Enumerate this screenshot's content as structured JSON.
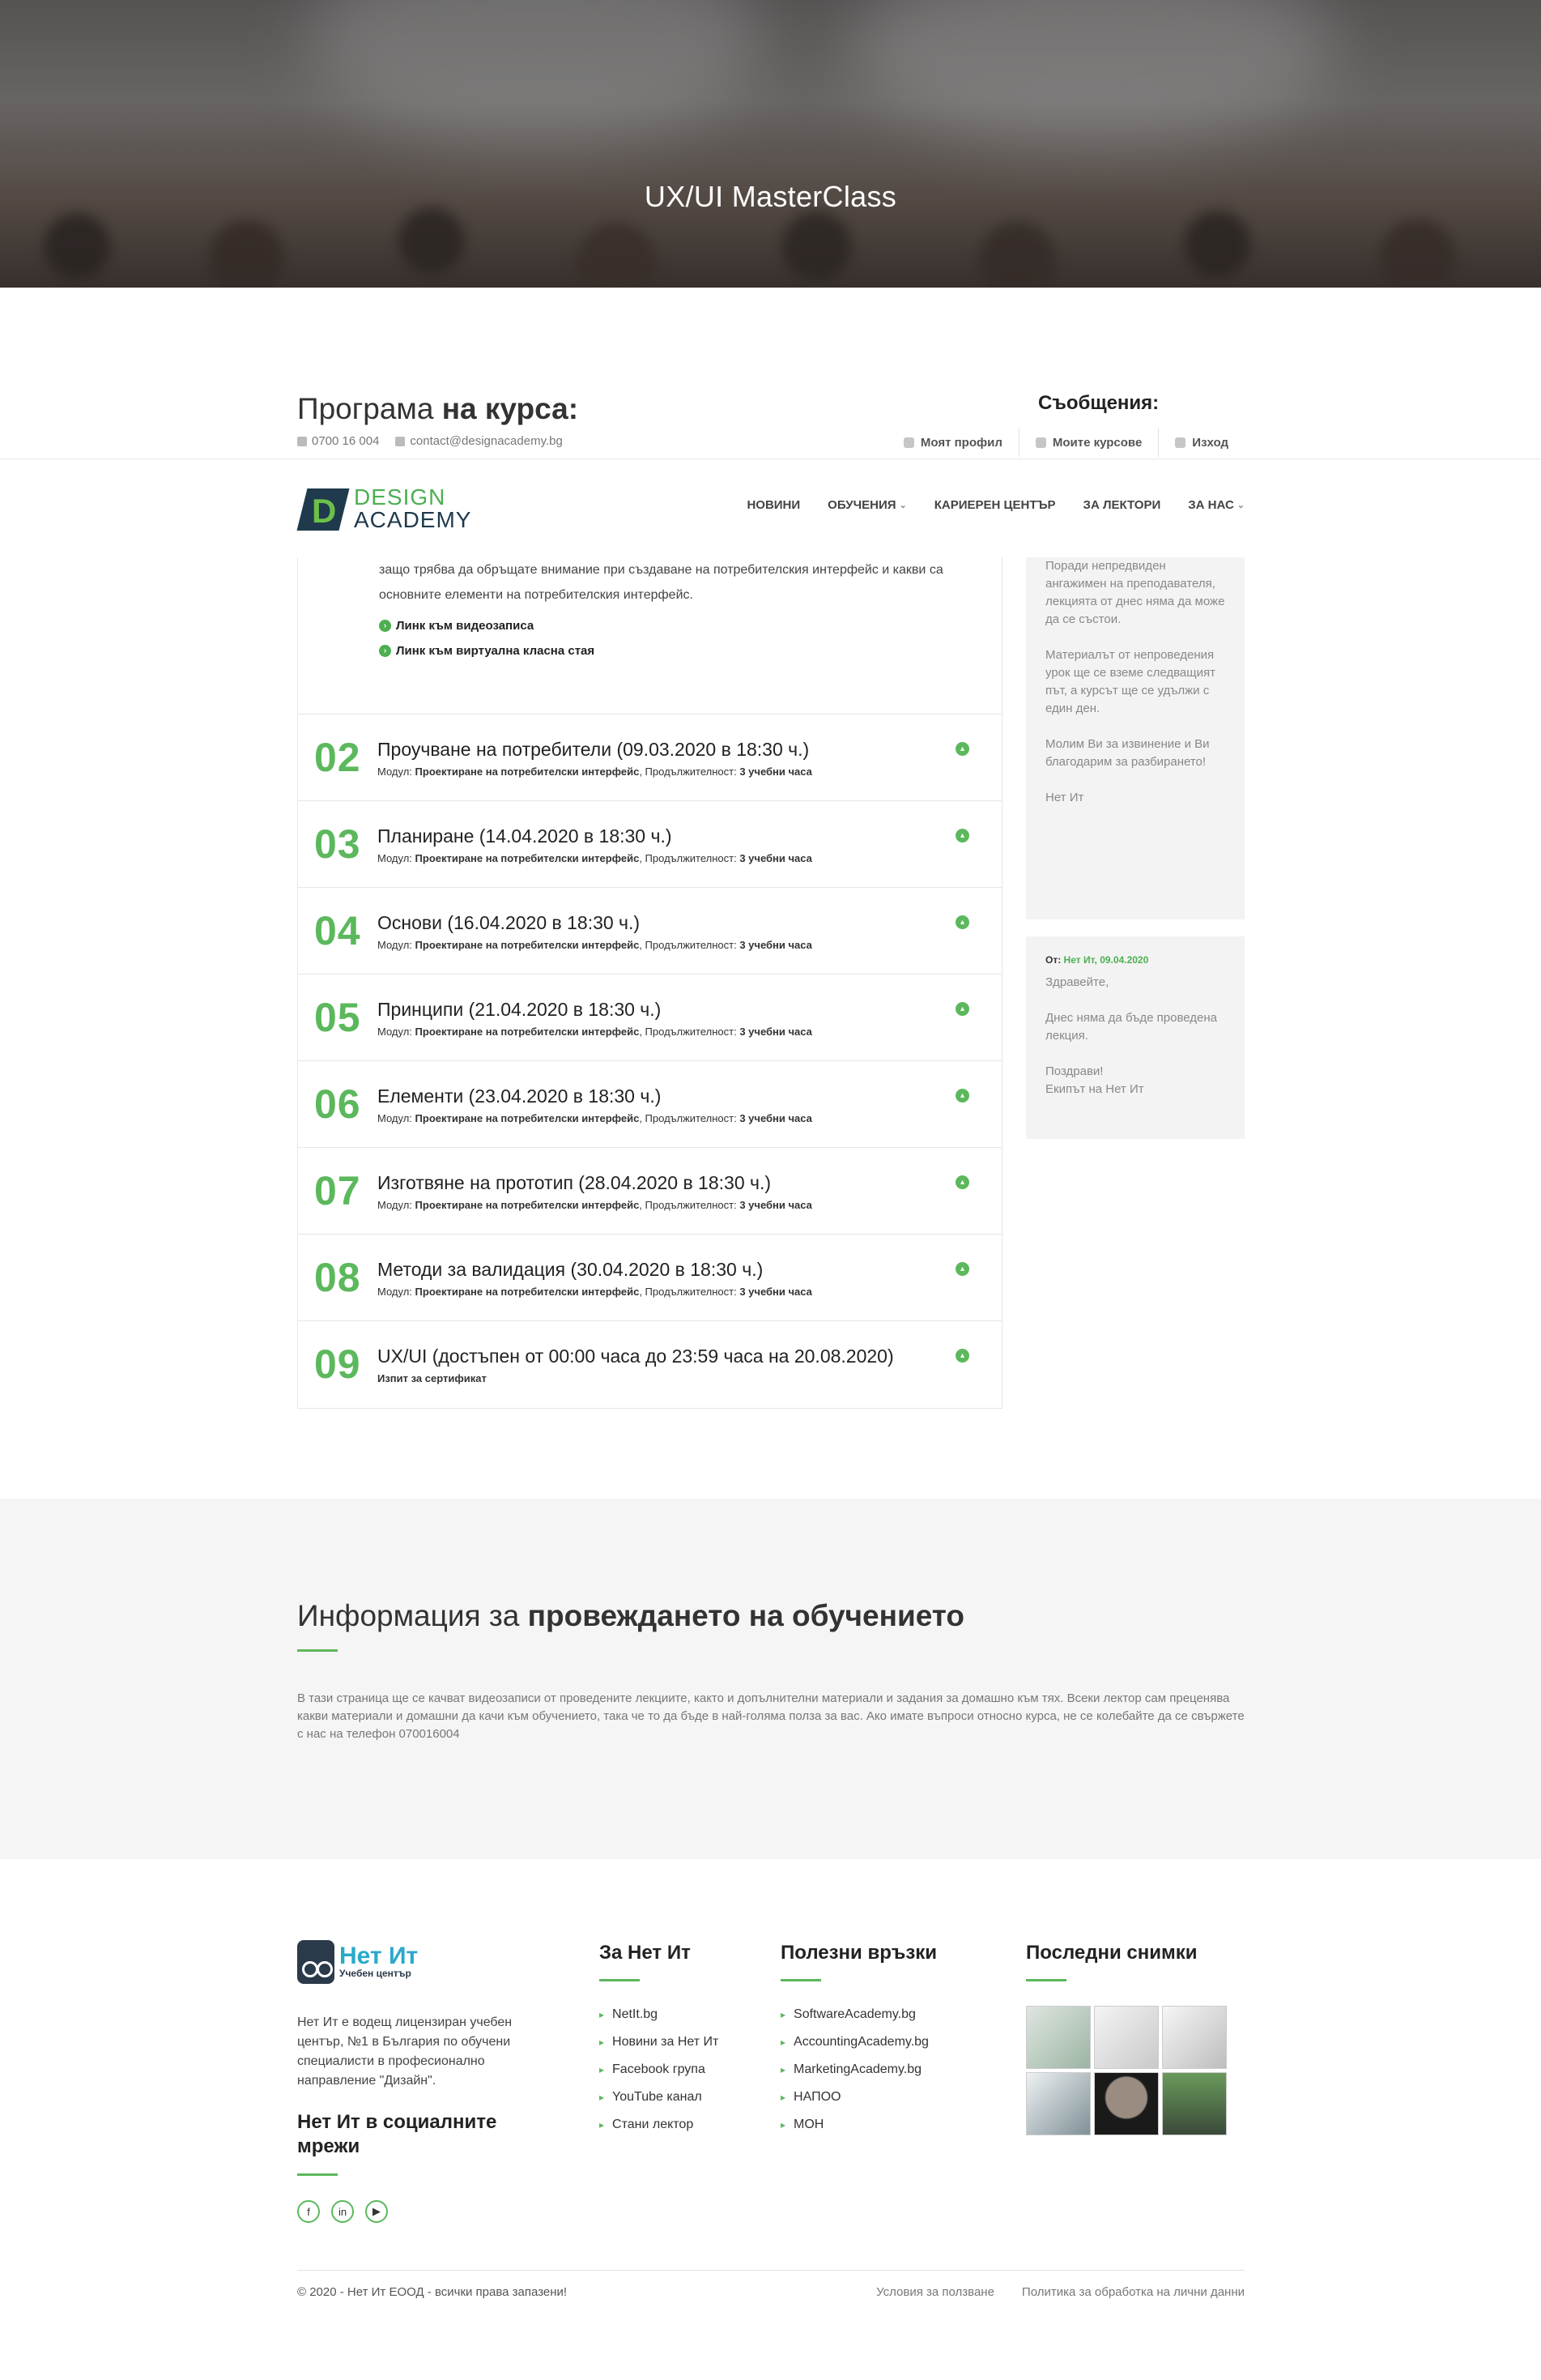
{
  "hero": {
    "title": "UX/UI MasterClass"
  },
  "header": {
    "program_light": "Програма ",
    "program_bold": "на курса:",
    "messages_title": "Съобщения:",
    "phone": "0700 16 004",
    "email": "contact@designacademy.bg",
    "user_menu": [
      "Моят профил",
      "Моите курсове",
      "Изход"
    ]
  },
  "nav": {
    "logo_line1": "DESIGN",
    "logo_line2": "ACADEMY",
    "logo_letter": "D",
    "items": [
      "НОВИНИ",
      "ОБУЧЕНИЯ",
      "КАРИЕРЕН ЦЕНТЪР",
      "ЗА ЛЕКТОРИ",
      "ЗА НАС"
    ]
  },
  "lesson_open": {
    "text": "защо трябва да обръщате внимание при създаване на потребителския интерфейс и какви са основните елементи на потребителския интерфейс.",
    "link_video": "Линк към видеозаписа",
    "link_class": "Линк към виртуална класна стая"
  },
  "lessons": [
    {
      "num": "02",
      "title": "Проучване на потребители (09.03.2020 в 18:30 ч.)",
      "sub_pre": "Модул: ",
      "sub_mod": "Проектиране на потребителски интерфейс",
      "sub_mid": ", Продължителност: ",
      "sub_dur": "3 учебни часа"
    },
    {
      "num": "03",
      "title": "Планиране (14.04.2020 в 18:30 ч.)",
      "sub_pre": "Модул: ",
      "sub_mod": "Проектиране на потребителски интерфейс",
      "sub_mid": ", Продължителност: ",
      "sub_dur": "3 учебни часа"
    },
    {
      "num": "04",
      "title": "Основи (16.04.2020 в 18:30 ч.)",
      "sub_pre": "Модул: ",
      "sub_mod": "Проектиране на потребителски интерфейс",
      "sub_mid": ", Продължителност: ",
      "sub_dur": "3 учебни часа"
    },
    {
      "num": "05",
      "title": "Принципи (21.04.2020 в 18:30 ч.)",
      "sub_pre": "Модул: ",
      "sub_mod": "Проектиране на потребителски интерфейс",
      "sub_mid": ", Продължителност: ",
      "sub_dur": "3 учебни часа"
    },
    {
      "num": "06",
      "title": "Елементи (23.04.2020 в 18:30 ч.)",
      "sub_pre": "Модул: ",
      "sub_mod": "Проектиране на потребителски интерфейс",
      "sub_mid": ", Продължителност: ",
      "sub_dur": "3 учебни часа"
    },
    {
      "num": "07",
      "title": "Изготвяне на прототип (28.04.2020 в 18:30 ч.)",
      "sub_pre": "Модул: ",
      "sub_mod": "Проектиране на потребителски интерфейс",
      "sub_mid": ", Продължителност: ",
      "sub_dur": "3 учебни часа"
    },
    {
      "num": "08",
      "title": "Методи за валидация (30.04.2020 в 18:30 ч.)",
      "sub_pre": "Модул: ",
      "sub_mod": "Проектиране на потребителски интерфейс",
      "sub_mid": ", Продължителност: ",
      "sub_dur": "3 учебни часа"
    },
    {
      "num": "09",
      "title": "UX/UI (достъпен от 00:00 часа до 23:59 часа на 20.08.2020)",
      "sub_pre": "",
      "sub_mod": "Изпит за сертификат",
      "sub_mid": "",
      "sub_dur": ""
    }
  ],
  "messages": {
    "m1": [
      "Поради непредвиден ангажимен на преподавателя, лекцията от днес няма да може да се състои.",
      "Материалът от непроведения урок ще се вземе следващият път, а курсът ще се удължи с един ден.",
      "Молим Ви за извинение и Ви благодарим за разбирането!",
      "Нет Ит"
    ],
    "m2_from_label": "От: ",
    "m2_from": "Нет Ит, 09.04.2020",
    "m2": [
      "Здравейте,",
      "Днес няма да бъде проведена лекция.",
      "Поздрави!",
      "Екипът на Нет Ит"
    ]
  },
  "info": {
    "title_light": "Информация за ",
    "title_bold": "провеждането на обучението",
    "text": "В тази страница ще се качват видеозаписи от проведените лекциите, както и допълнителни материали и задания за домашно към тях. Всеки лектор сам преценява какви материали и домашни да качи към обучението, така че то да бъде в най-голяма полза за вас. Ако имате въпроси относно курса, не се колебайте да се свържете с нас на телефон 070016004"
  },
  "footer": {
    "logo_name": "Нет Ит",
    "logo_sub": "Учебен център",
    "about": "Нет Ит е водещ лицензиран учебен център, №1 в България по обучени специалисти в професионално направление \"Дизайн\".",
    "social_title": "Нет Ит в социалните мрежи",
    "social": [
      "f",
      "in",
      "▶"
    ],
    "col1_title": "За Нет Ит",
    "col1": [
      "NetIt.bg",
      "Новини за Нет Ит",
      "Facebook група",
      "YouTube канал",
      "Стани лектор"
    ],
    "col2_title": "Полезни връзки",
    "col2": [
      "SoftwareAcademy.bg",
      "AccountingAcademy.bg",
      "MarketingAcademy.bg",
      "НАПОО",
      "МОН"
    ],
    "col3_title": "Последни снимки",
    "copyright": "© 2020 - Нет Ит ЕООД - всички права запазени!",
    "terms": "Условия за ползване",
    "privacy": "Политика за обработка на лични данни"
  },
  "colors": {
    "accent": "#5cb85c",
    "dark": "#1f3a4d",
    "netit_blue": "#2aa9c9"
  }
}
